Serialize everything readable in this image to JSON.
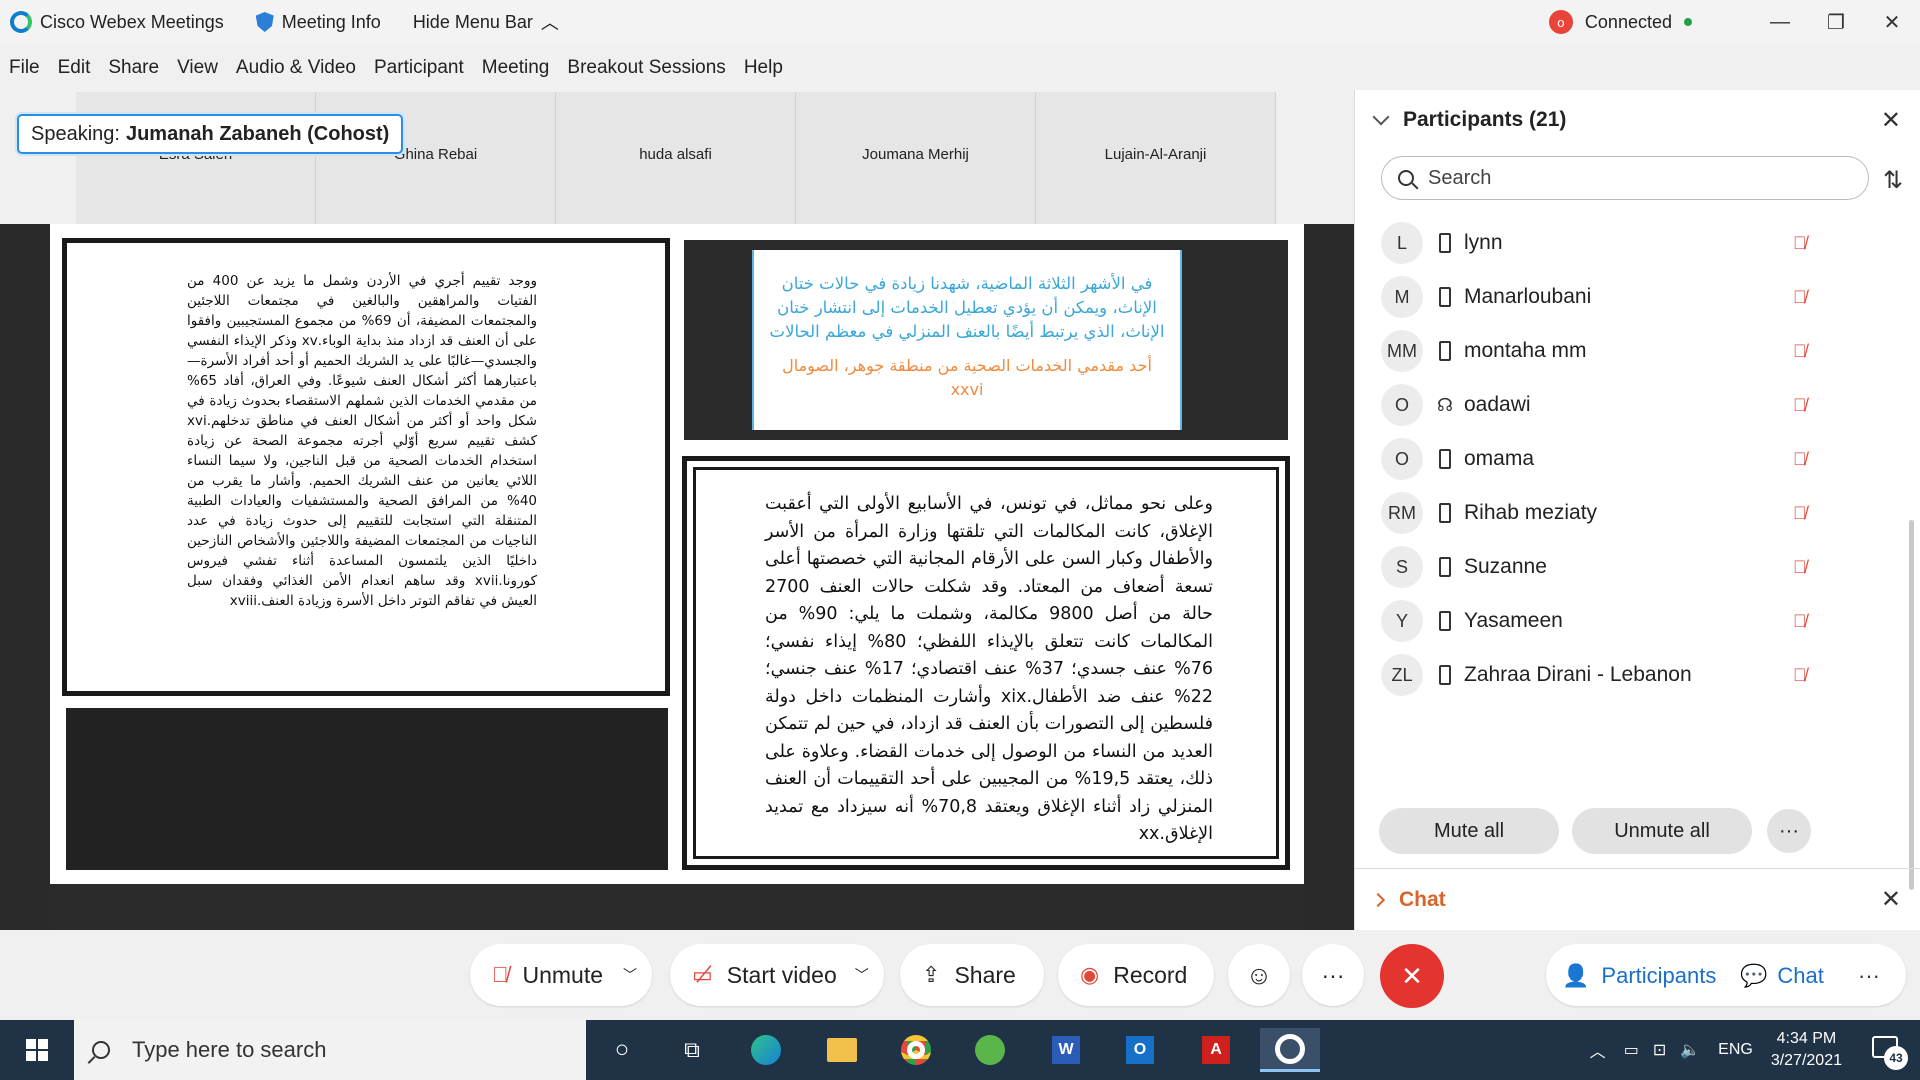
{
  "titlebar": {
    "app_name": "Cisco Webex Meetings",
    "meeting_info": "Meeting Info",
    "hide_menu": "Hide Menu Bar",
    "status": "Connected",
    "status_color": "#22a046"
  },
  "menu": [
    "File",
    "Edit",
    "Share",
    "View",
    "Audio & Video",
    "Participant",
    "Meeting",
    "Breakout Sessions",
    "Help"
  ],
  "speaking": {
    "prefix": "Speaking:",
    "name": "Jumanah Zabaneh (Cohost)"
  },
  "video_tiles": [
    "Esra Salen",
    "Ghina Rebai",
    "huda alsafi",
    "Joumana Merhij",
    "Lujain-Al-Aranji"
  ],
  "document": {
    "left_text": "ووجد تقييم أجري في الأردن وشمل ما يزيد عن 400 من الفتيات والمراهقين والبالغين في مجتمعات اللاجئين والمجتمعات المضيفة، أن 69% من مجموع المستجيبين وافقوا على أن العنف قد ازداد منذ بداية الوباء.xv وذكر الإيذاء النفسي والجسدي—غالبًا على يد الشريك الحميم أو أحد أفراد الأسرة—باعتبارهما أكثر أشكال العنف شيوعًا. وفي العراق، أفاد 65% من مقدمي الخدمات الذين شملهم الاستقصاء بحدوث زيادة في شكل واحد أو أكثر من أشكال العنف في مناطق تدخلهم.xvi كشف تقييم سريع أوّلي أجرته مجموعة الصحة عن زيادة استخدام الخدمات الصحية من قبل الناجين، ولا سيما النساء اللائي يعانين من عنف الشريك الحميم. وأشار ما يقرب من 40% من المرافق الصحية والمستشفيات والعيادات الطبية المتنقلة التي استجابت للتقييم إلى حدوث زيادة في عدد الناجيات من المجتمعات المضيفة واللاجئين والأشخاص النازحين داخليًا الذين يلتمسون المساعدة أثناء تفشي فيروس كورونا.xvii وقد ساهم انعدام الأمن الغذائي وفقدان سبل العيش في تفاقم التوتر داخل الأسرة وزيادة العنف.xviii",
    "quote_text": "في الأشهر الثلاثة الماضية، شهدنا زيادة في حالات ختان الإناث، ويمكن أن يؤدي تعطيل الخدمات إلى انتشار ختان الإناث، الذي يرتبط أيضًا بالعنف المنزلي في معظم الحالات",
    "quote_source": "أحد مقدمي الخدمات الصحية من منطقة جوهر، الصومال xxvi",
    "quote_color": "#3aa7d8",
    "source_color": "#f08a3e",
    "right_text": "وعلى نحو مماثل، في تونس، في الأسابيع الأولى التي أعقبت الإغلاق، كانت المكالمات التي تلقتها وزارة المرأة من الأسر والأطفال وكبار السن على الأرقام المجانية التي خصصتها أعلى تسعة أضعاف من المعتاد. وقد شكلت حالات العنف 2700 حالة من أصل 9800 مكالمة، وشملت ما يلي: 90% من المكالمات كانت تتعلق بالإيذاء اللفظي؛ 80% إيذاء نفسي؛ 76% عنف جسدي؛ 37% عنف اقتصادي؛ 17% عنف جنسي؛ 22% عنف ضد الأطفال.xix وأشارت المنظمات داخل دولة فلسطين إلى التصورات بأن العنف قد ازداد، في حين لم تتمكن العديد من النساء من الوصول إلى خدمات القضاء. وعلاوة على ذلك، يعتقد 19,5% من المجيبين على أحد التقييمات أن العنف المنزلي زاد أثناء الإغلاق ويعتقد 70,8% أنه سيزداد مع تمديد الإغلاق.xx"
  },
  "participants": {
    "title": "Participants (21)",
    "search_placeholder": "Search",
    "list": [
      {
        "initials": "L",
        "name": "lynn",
        "device": "phone-icon"
      },
      {
        "initials": "M",
        "name": "Manarloubani",
        "device": "phone-icon"
      },
      {
        "initials": "MM",
        "name": "montaha mm",
        "device": "phone-icon"
      },
      {
        "initials": "O",
        "name": "oadawi",
        "device": "headset-icon"
      },
      {
        "initials": "O",
        "name": "omama",
        "device": "phone-icon"
      },
      {
        "initials": "RM",
        "name": "Rihab meziaty",
        "device": "phone-icon"
      },
      {
        "initials": "S",
        "name": "Suzanne",
        "device": "phone-icon"
      },
      {
        "initials": "Y",
        "name": "Yasameen",
        "device": "phone-icon"
      },
      {
        "initials": "ZL",
        "name": "Zahraa Dirani - Lebanon",
        "device": "phone-icon"
      }
    ],
    "mute_all": "Mute all",
    "unmute_all": "Unmute all",
    "more": "···"
  },
  "chat": {
    "title": "Chat"
  },
  "controls": {
    "unmute": "Unmute",
    "start_video": "Start video",
    "share": "Share",
    "record": "Record",
    "more": "···",
    "participants": "Participants",
    "chat": "Chat",
    "end_color": "#e3342f",
    "link_color": "#1b6fc9"
  },
  "taskbar": {
    "search_placeholder": "Type here to search",
    "language": "ENG",
    "time": "4:34 PM",
    "date": "3/27/2021",
    "notifications": "43"
  }
}
